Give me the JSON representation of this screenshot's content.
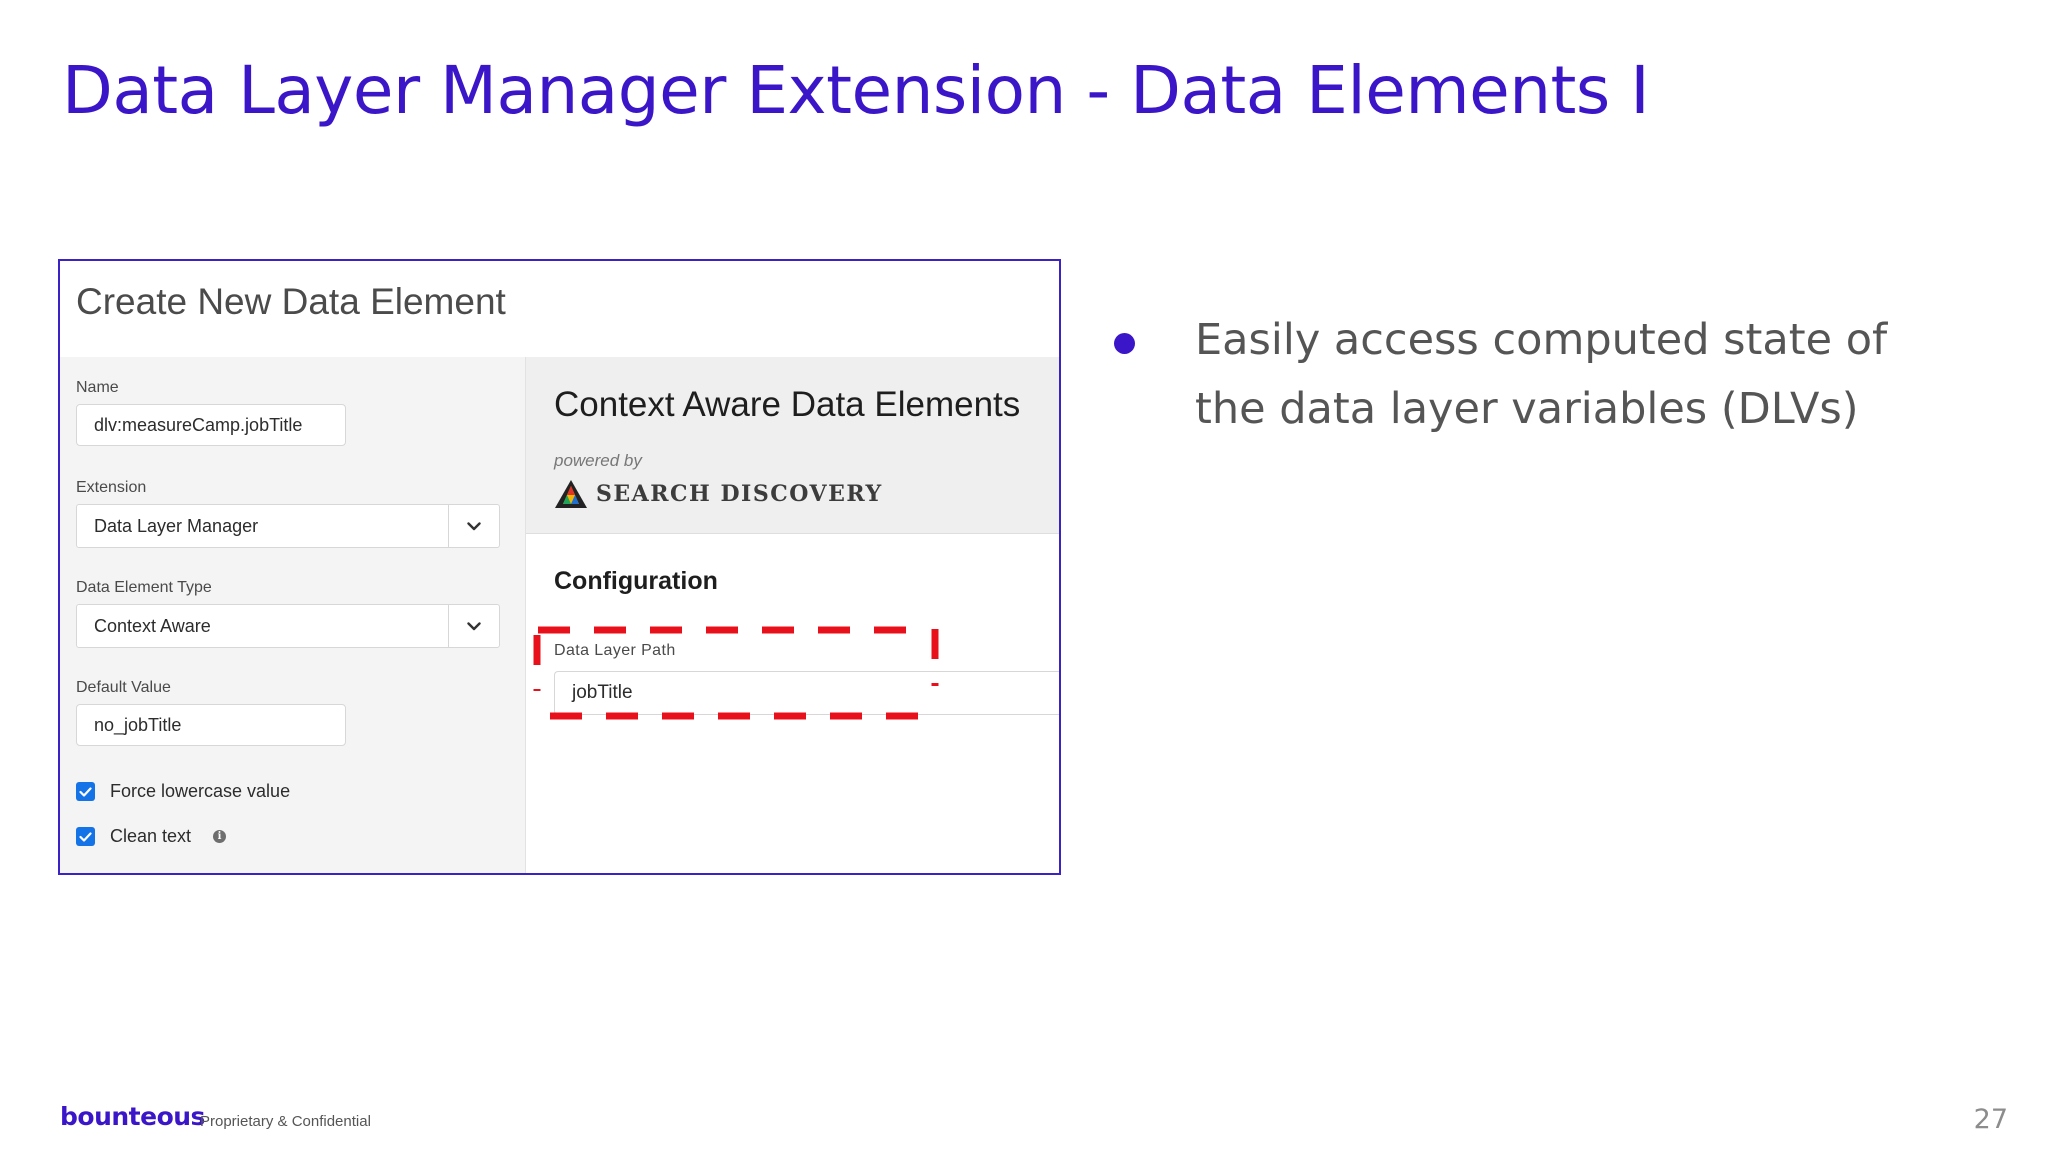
{
  "slide": {
    "title": "Data Layer Manager Extension - Data Elements I",
    "bullets": [
      "Easily access computed state of the data layer variables (DLVs)"
    ],
    "page_number": "27"
  },
  "screenshot": {
    "title": "Create New Data Element",
    "name_label": "Name",
    "name_value": "dlv:measureCamp.jobTitle",
    "extension_label": "Extension",
    "extension_value": "Data Layer Manager",
    "type_label": "Data Element Type",
    "type_value": "Context Aware",
    "default_label": "Default Value",
    "default_value": "no_jobTitle",
    "checkboxes": [
      {
        "label": "Force lowercase value",
        "checked": true
      },
      {
        "label": "Clean text",
        "checked": true
      }
    ],
    "extension_panel": {
      "title": "Context Aware Data Elements",
      "powered_by": "powered by",
      "brand": "SEARCH DISCOVERY",
      "config_heading": "Configuration",
      "path_label": "Data Layer Path",
      "path_value": "jobTitle"
    },
    "colors": {
      "accent": "#3a16c8",
      "checkbox": "#1473e6",
      "highlight": "#e8101a"
    }
  },
  "footer": {
    "logo": "bounteous",
    "note": "Proprietary & Confidential"
  },
  "icons": [
    "chevron-down-icon",
    "checkmark-icon",
    "info-icon",
    "search-discovery-logo-icon",
    "bullet-dot-icon"
  ]
}
